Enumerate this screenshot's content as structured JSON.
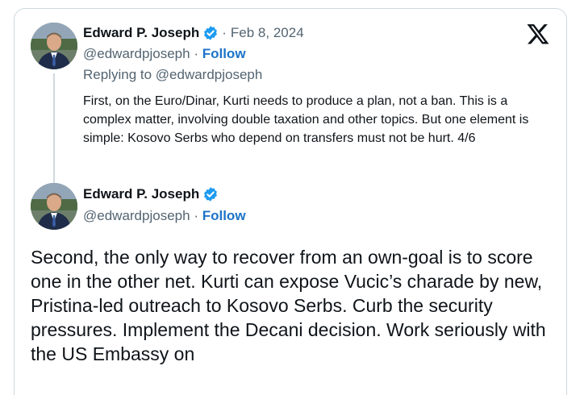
{
  "quoted_tweet": {
    "author_name": "Edward P. Joseph",
    "date": "Feb 8, 2024",
    "handle": "@edwardpjoseph",
    "follow_label": "Follow",
    "separator": "·",
    "replying_to": "Replying to @edwardpjoseph",
    "text": "First, on the Euro/Dinar, Kurti needs to produce a plan, not a ban. This is a complex matter, involving double taxation and other topics. But one element is simple: Kosovo Serbs who depend on transfers must not be hurt. 4/6"
  },
  "main_tweet": {
    "author_name": "Edward P. Joseph",
    "handle": "@edwardpjoseph",
    "follow_label": "Follow",
    "separator": "·",
    "text": "Second, the only way to recover from an own-goal is to score one in the other net. Kurti can expose Vucic’s charade by new, Pristina-led outreach to Kosovo Serbs. Curb the security pressures. Implement the Decani decision. Work seriously with the US Embassy on"
  },
  "icons": {
    "brand": "x-logo-icon",
    "verified": "verified-badge-icon"
  },
  "colors": {
    "link": "#1d74c8",
    "verified": "#1d9bf0",
    "muted": "#536471",
    "border": "#cfd9de"
  }
}
